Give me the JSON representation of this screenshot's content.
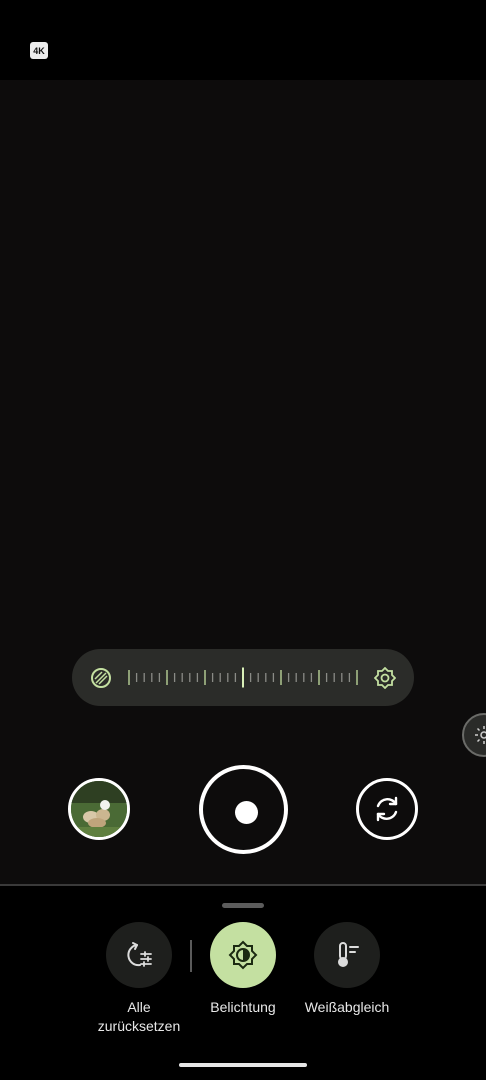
{
  "status": {
    "resolution_badge": "4K"
  },
  "exposure_slider": {
    "left_icon": "shadow-icon",
    "right_icon": "brightness-icon",
    "accent_color": "#c4e0a1",
    "level": 0.5
  },
  "side_panel": {
    "icon": "brightness-small-icon"
  },
  "capture": {
    "thumbnail_icon": "gallery-thumbnail",
    "shutter_icon": "record-button",
    "switch_icon": "switch-camera-icon"
  },
  "controls": [
    {
      "label": "Alle\nzurücksetzen",
      "icon": "reset-settings-icon",
      "active": false
    },
    {
      "label": "Belichtung",
      "icon": "exposure-icon",
      "active": true
    },
    {
      "label": "Weißabgleich",
      "icon": "white-balance-icon",
      "active": false
    }
  ],
  "colors": {
    "active_control": "#c4e0a1",
    "inactive_control": "#1e1f1d"
  }
}
